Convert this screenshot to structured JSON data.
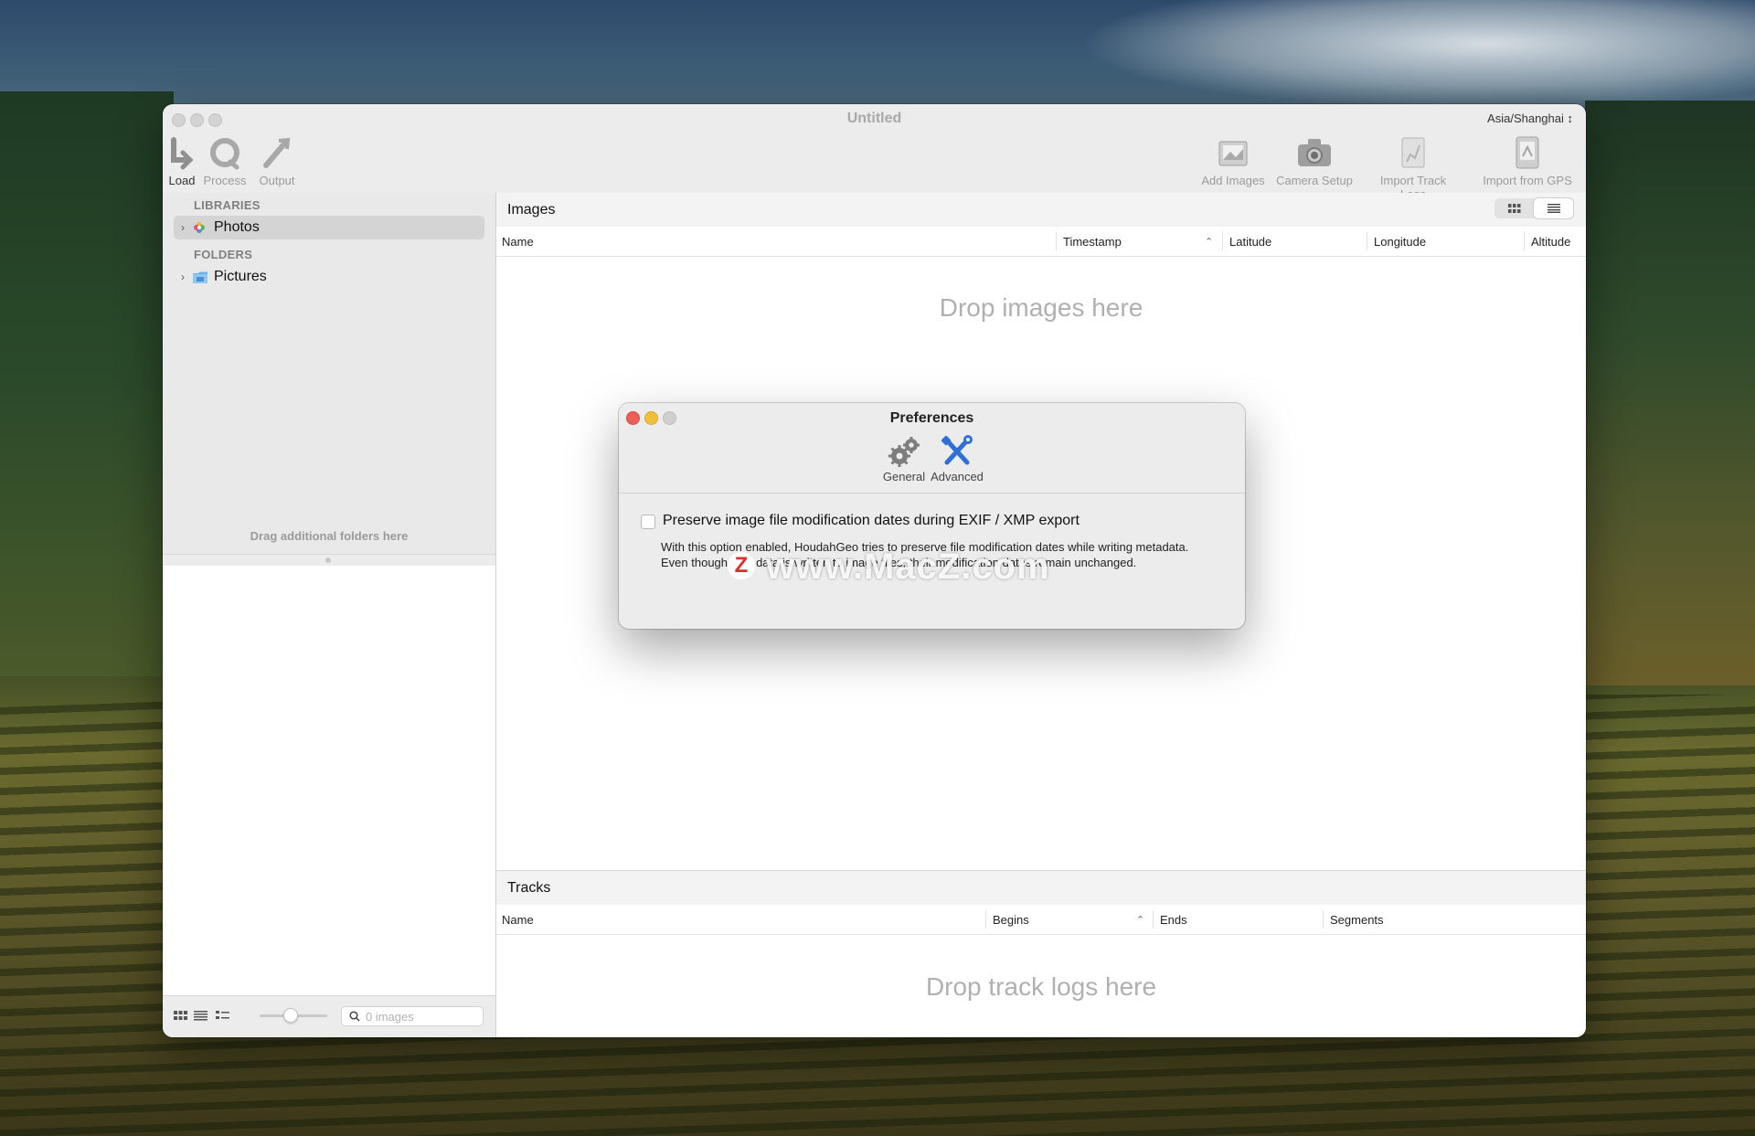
{
  "window": {
    "title": "Untitled",
    "timezone": "Asia/Shanghai ↕"
  },
  "toolbar": {
    "left": [
      {
        "label": "Load",
        "icon": "load-icon"
      },
      {
        "label": "Process",
        "icon": "process-icon"
      },
      {
        "label": "Output",
        "icon": "output-icon"
      }
    ],
    "right": [
      {
        "label": "Add Images",
        "icon": "add-images-icon"
      },
      {
        "label": "Camera Setup",
        "icon": "camera-icon"
      },
      {
        "label": "Import Track Logs",
        "icon": "import-track-logs-icon"
      },
      {
        "label": "Import from GPS",
        "icon": "import-gps-icon"
      }
    ]
  },
  "sidebar": {
    "libraries_heading": "LIBRARIES",
    "libraries": [
      {
        "label": "Photos",
        "icon": "photos-icon"
      }
    ],
    "folders_heading": "FOLDERS",
    "folders": [
      {
        "label": "Pictures",
        "icon": "folder-icon"
      }
    ],
    "drag_hint": "Drag additional folders here",
    "search_placeholder": "0 images"
  },
  "images_pane": {
    "title": "Images",
    "columns": [
      "Name",
      "Timestamp",
      "Latitude",
      "Longitude",
      "Altitude"
    ],
    "drop_text": "Drop images here"
  },
  "tracks_pane": {
    "title": "Tracks",
    "columns": [
      "Name",
      "Begins",
      "Ends",
      "Segments"
    ],
    "drop_text": "Drop track logs here"
  },
  "preferences": {
    "title": "Preferences",
    "tabs": [
      {
        "label": "General",
        "icon": "gears-icon"
      },
      {
        "label": "Advanced",
        "icon": "tools-icon"
      }
    ],
    "checkbox_label": "Preserve image file modification dates during EXIF / XMP export",
    "checkbox_checked": false,
    "description": "With this option enabled, HoudahGeo tries to preserve file modification dates while writing metadata. Even though new data is written to image files, their modification dates remain unchanged."
  },
  "watermark": {
    "text": "www.MacZ.com",
    "badge": "Z"
  },
  "colors": {
    "close": "#ec5f57",
    "minimize": "#f2bf3d",
    "zoom": "#cfcfcf",
    "accent": "#3a7bd5"
  }
}
